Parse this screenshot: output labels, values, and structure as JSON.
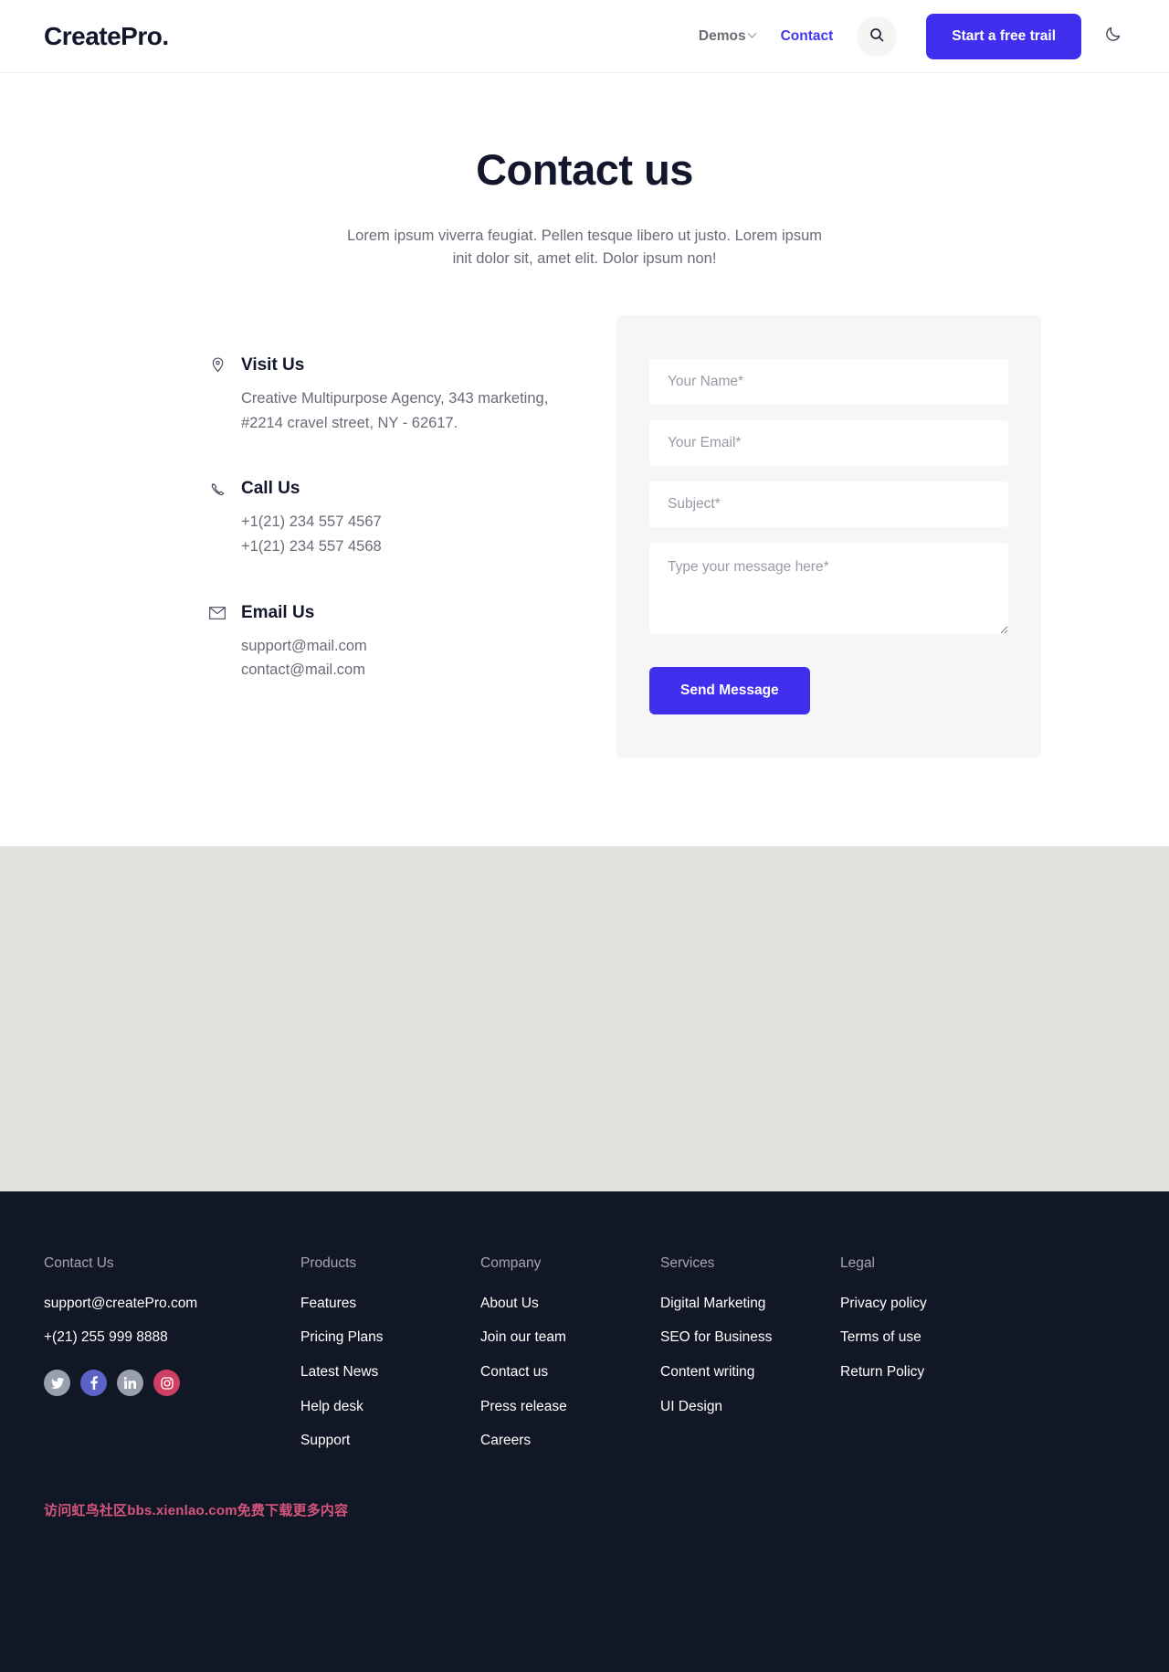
{
  "header": {
    "brand": "CreatePro.",
    "nav": [
      {
        "label": "Demos",
        "has_caret": true,
        "active": false
      },
      {
        "label": "Contact",
        "has_caret": false,
        "active": true
      }
    ],
    "search_icon": "search-icon",
    "cta_label": "Start a free trail",
    "mode_icon": "moon-icon",
    "accent_color": "#4030ee"
  },
  "hero": {
    "title": "Contact us",
    "subtitle": "Lorem ipsum viverra feugiat. Pellen tesque libero ut justo. Lorem ipsum init dolor sit, amet elit. Dolor ipsum non!"
  },
  "contact_info": [
    {
      "icon": "location-pin-icon",
      "title": "Visit Us",
      "lines": [
        "Creative Multipurpose Agency, 343 marketing,",
        "#2214 cravel street, NY - 62617."
      ]
    },
    {
      "icon": "phone-icon",
      "title": "Call Us",
      "lines": [
        "+1(21) 234 557 4567",
        "+1(21) 234 557 4568"
      ]
    },
    {
      "icon": "envelope-icon",
      "title": "Email Us",
      "lines": [
        "support@mail.com",
        "contact@mail.com"
      ]
    }
  ],
  "form": {
    "name_placeholder": "Your Name*",
    "name_value": "",
    "email_placeholder": "Your Email*",
    "email_value": "",
    "subject_placeholder": "Subject*",
    "subject_value": "",
    "message_placeholder": "Type your message here*",
    "message_value": "",
    "submit_label": "Send Message"
  },
  "footer": {
    "columns": [
      {
        "heading": "Contact Us",
        "items": [
          "support@createPro.com",
          "+(21) 255 999 8888"
        ]
      },
      {
        "heading": "Products",
        "items": [
          "Features",
          "Pricing Plans",
          "Latest News",
          "Help desk",
          "Support"
        ]
      },
      {
        "heading": "Company",
        "items": [
          "About Us",
          "Join our team",
          "Contact us",
          "Press release",
          "Careers"
        ]
      },
      {
        "heading": "Services",
        "items": [
          "Digital Marketing",
          "SEO for Business",
          "Content writing",
          "UI Design"
        ]
      },
      {
        "heading": "Legal",
        "items": [
          "Privacy policy",
          "Terms of use",
          "Return Policy"
        ]
      }
    ],
    "social": [
      {
        "name": "twitter-icon",
        "color": "#97a0ae"
      },
      {
        "name": "facebook-icon",
        "color": "#5b63c9"
      },
      {
        "name": "linkedin-icon",
        "color": "#9aa0ab"
      },
      {
        "name": "instagram-icon",
        "color": "#cf3f63"
      }
    ],
    "watermark": "访问虹鸟社区bbs.xienlao.com免费下载更多内容"
  }
}
